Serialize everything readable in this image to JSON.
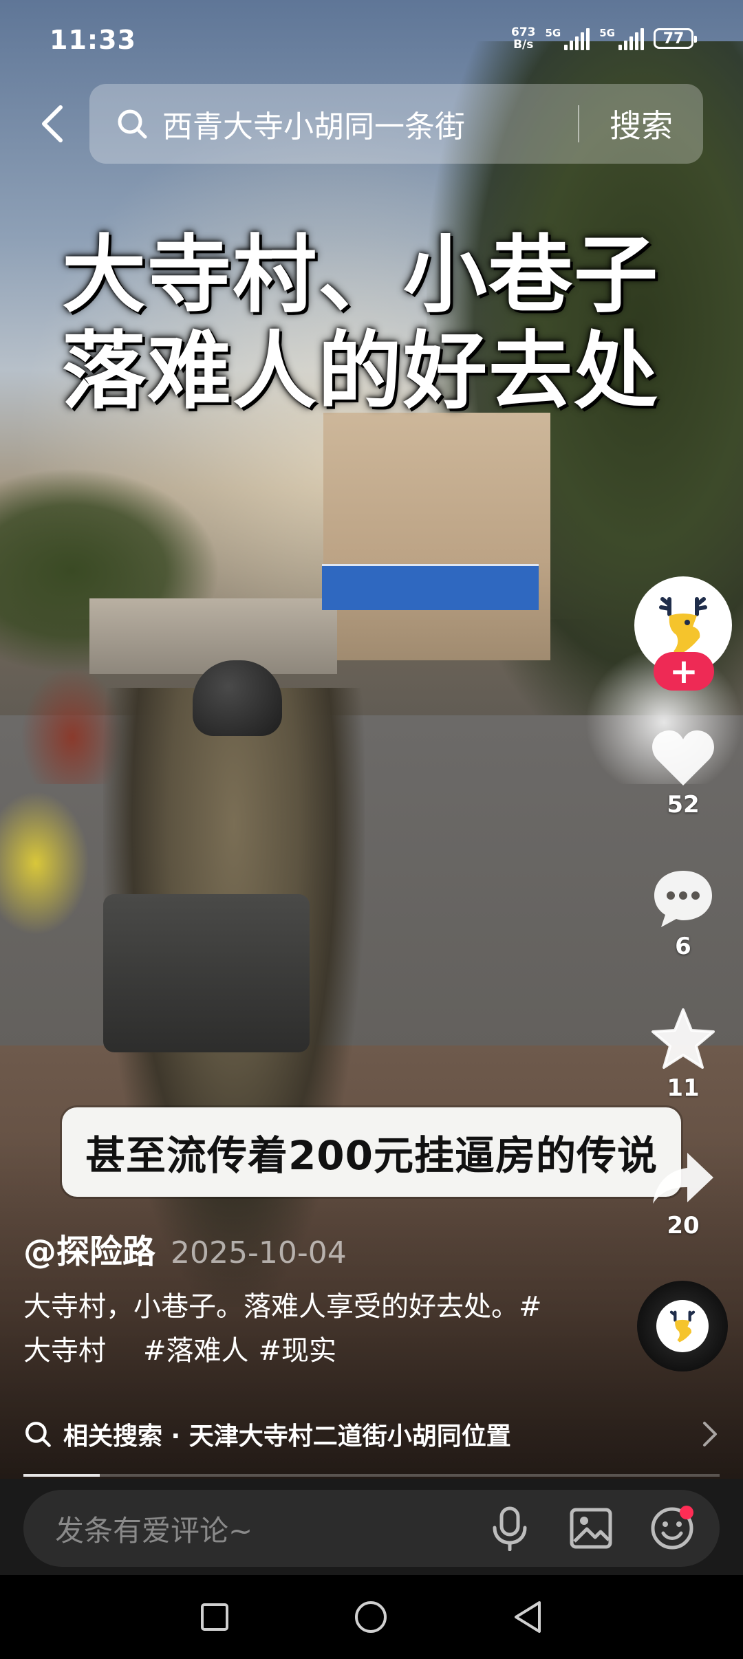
{
  "status_bar": {
    "time": "11:33",
    "net_speed_value": "673",
    "net_speed_unit": "B/s",
    "sim1_label": "5G",
    "sim2_label": "5G",
    "battery": "77"
  },
  "search": {
    "query": "西青大寺小胡同一条街",
    "button_label": "搜索"
  },
  "video": {
    "title_overlay": "大寺村、小巷子\n落难人的好去处",
    "subtitle": "甚至流传着200元挂逼房的传说",
    "progress": 0.11
  },
  "actions": {
    "follow_label": "+",
    "likes": "52",
    "comments": "6",
    "favorites": "11",
    "shares": "20"
  },
  "post": {
    "author": "@探险路",
    "date": "2025-10-04",
    "caption_text": "大寺村，小巷子。落难人享受的好去处。",
    "hashtags": [
      "#大寺村",
      "#落难人",
      "#现实"
    ]
  },
  "related_search": {
    "label": "相关搜索 · 天津大寺村二道街小胡同位置"
  },
  "comment_bar": {
    "placeholder": "发条有爱评论~"
  },
  "colors": {
    "accent": "#ee2a55",
    "notification_dot": "#ff2d55"
  },
  "icons": [
    "back-arrow-icon",
    "search-icon",
    "heart-icon",
    "comment-icon",
    "star-icon",
    "share-icon",
    "microphone-icon",
    "image-icon",
    "emoji-icon",
    "recent-apps-icon",
    "home-icon",
    "back-icon"
  ]
}
